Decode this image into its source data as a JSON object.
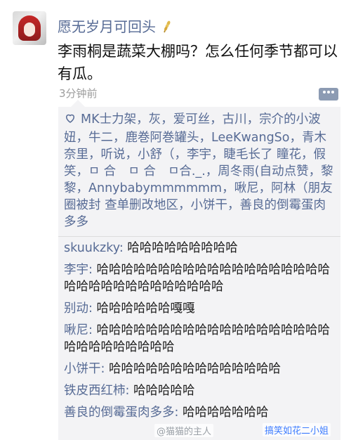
{
  "post": {
    "username": "愿无岁月可回头",
    "text": "李雨桐是蔬菜大棚吗？怎么任何季节都可以有瓜。",
    "time": "3分钟前"
  },
  "likes": {
    "text": "MK士力架，灰，爱可丝，古川，宗介的小波妞，牛二，鹿巻阿巻罐头，LeeKwangSo，青木奈里，听说，小舒（，李宇，睫毛长了 瞳花，假笑，ㅁ 合　ㅁ 合　ㅁ合._.，周冬雨(自动点赞，黎黎，Annybabymmmmmm，啾尼，阿林（朋友圈被封 查单删改地区，小饼干，善良的倒霉蛋肉多多"
  },
  "comments": [
    {
      "author": "skuukzky",
      "text": "哈哈哈哈哈哈哈哈哈"
    },
    {
      "author": "李宇",
      "text": "哈哈哈哈哈哈哈哈哈哈哈哈哈哈哈哈哈哈哈哈哈哈哈哈哈哈哈哈哈哈哈哈"
    },
    {
      "author": "别动",
      "text": "哈哈哈哈哈哈嘎嘎"
    },
    {
      "author": "啾尼",
      "text": "哈哈哈哈哈哈哈哈哈哈哈哈哈哈哈哈哈哈哈哈哈哈哈哈哈哈哈哈"
    },
    {
      "author": "小饼干",
      "text": "哈哈哈哈哈哈哈哈哈哈哈哈哈哈"
    },
    {
      "author": "铁皮西红柿",
      "text": "哈哈哈哈哈"
    },
    {
      "author": "善良的倒霉蛋肉多多",
      "text": "哈哈哈哈哈哈哈"
    }
  ],
  "watermarks": {
    "left": "@猫猫的主人",
    "right": "搞笑如花二小姐"
  },
  "colors": {
    "link": "#576b95",
    "comment_bg": "#f3f3f5",
    "time": "#9c9c9c"
  },
  "icons": {
    "name_suffix": "wheat-icon",
    "like": "heart-icon",
    "more": "more-dots-icon"
  }
}
